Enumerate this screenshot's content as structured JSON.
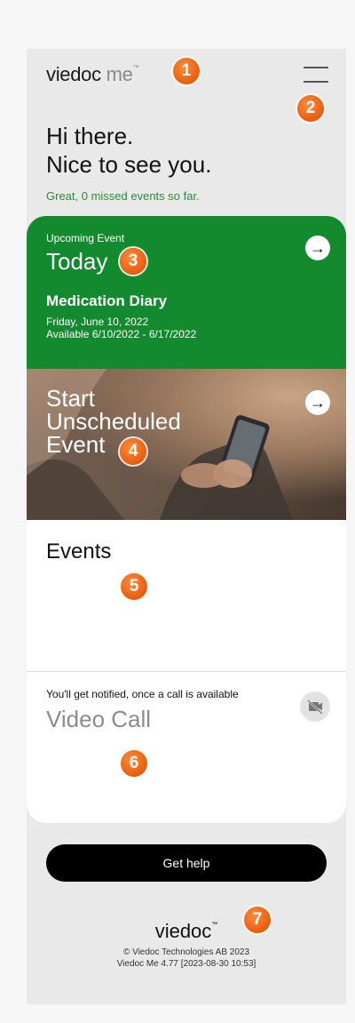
{
  "header": {
    "logo_brand": "viedoc",
    "logo_me": "me",
    "logo_tm": "™"
  },
  "markers": [
    "1",
    "2",
    "3",
    "4",
    "5",
    "6",
    "7"
  ],
  "greeting": {
    "line1": "Hi there.",
    "line2": "Nice to see you.",
    "missed": "Great, 0 missed events so far."
  },
  "upcoming": {
    "label": "Upcoming Event",
    "when": "Today",
    "title": "Medication Diary",
    "date": "Friday, June 10, 2022",
    "available": "Available 6/10/2022 - 6/17/2022",
    "arrow": "→"
  },
  "unscheduled": {
    "line1": "Start",
    "line2": "Unscheduled",
    "line3": "Event",
    "arrow": "→"
  },
  "events": {
    "title": "Events"
  },
  "video_call": {
    "note": "You'll get notified, once a call is available",
    "title": "Video Call",
    "icon": "video-off-icon"
  },
  "help": {
    "label": "Get help"
  },
  "footer": {
    "logo": "viedoc",
    "tm": "™",
    "copyright": "© Viedoc Technologies AB 2023",
    "version": "Viedoc Me 4.77 [2023-08-30 10:53]"
  },
  "colors": {
    "green": "#128a2d",
    "marker": "#e85d0c",
    "background": "#e9e9e9"
  }
}
